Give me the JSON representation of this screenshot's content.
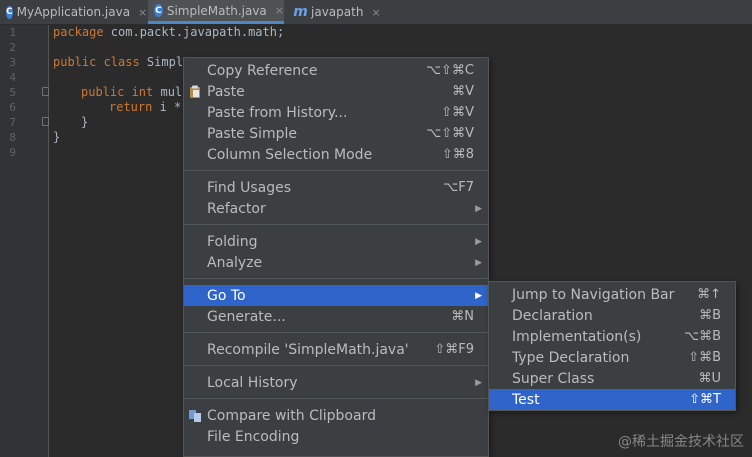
{
  "tabs": [
    {
      "label": "MyApplication.java",
      "icon": "java-class-icon",
      "active": false
    },
    {
      "label": "SimpleMath.java",
      "icon": "java-class-icon",
      "active": true
    },
    {
      "label": "javapath",
      "icon": "module-m-icon",
      "active": false
    }
  ],
  "tab_close": "×",
  "gutter": {
    "line_numbers": [
      "1",
      "2",
      "3",
      "4",
      "5",
      "6",
      "7",
      "8",
      "9"
    ]
  },
  "code": {
    "line1_kw": "package",
    "line1_rest": " com.packt.javapath.math;",
    "line3_kw": "public class",
    "line3_rest": " Simple",
    "line5_kw": "public int",
    "line5_rest": " mult",
    "line6_kw": "return",
    "line6_rest": " i *",
    "line7": "}",
    "line8": "}"
  },
  "context_menu": {
    "items": [
      {
        "label": "Copy Reference",
        "shortcut": "⌥⇧⌘C"
      },
      {
        "label": "Paste",
        "shortcut": "⌘V",
        "icon": "paste-icon"
      },
      {
        "label": "Paste from History...",
        "shortcut": "⇧⌘V"
      },
      {
        "label": "Paste Simple",
        "shortcut": "⌥⇧⌘V"
      },
      {
        "label": "Column Selection Mode",
        "shortcut": "⇧⌘8"
      },
      {
        "label": "Find Usages",
        "shortcut": "⌥F7"
      },
      {
        "label": "Refactor",
        "submenu": true
      },
      {
        "label": "Folding",
        "submenu": true
      },
      {
        "label": "Analyze",
        "submenu": true
      },
      {
        "label": "Go To",
        "submenu": true,
        "selected": true
      },
      {
        "label": "Generate...",
        "shortcut": "⌘N"
      },
      {
        "label": "Recompile 'SimpleMath.java'",
        "shortcut": "⇧⌘F9"
      },
      {
        "label": "Local History",
        "submenu": true
      },
      {
        "label": "Compare with Clipboard",
        "icon": "compare-icon"
      },
      {
        "label": "File Encoding"
      }
    ],
    "arrow_glyph": "▶"
  },
  "goto_submenu": {
    "items": [
      {
        "label": "Jump to Navigation Bar",
        "shortcut": "⌘↑"
      },
      {
        "label": "Declaration",
        "shortcut": "⌘B"
      },
      {
        "label": "Implementation(s)",
        "shortcut": "⌥⌘B"
      },
      {
        "label": "Type Declaration",
        "shortcut": "⇧⌘B"
      },
      {
        "label": "Super Class",
        "shortcut": "⌘U"
      },
      {
        "label": "Test",
        "shortcut": "⇧⌘T",
        "selected": true
      }
    ]
  },
  "watermark": "@稀土掘金技术社区",
  "colors": {
    "selection": "#2f65ca",
    "keyword": "#cc7832",
    "editor_bg": "#2b2b2b",
    "menu_bg": "#3c3f41"
  }
}
